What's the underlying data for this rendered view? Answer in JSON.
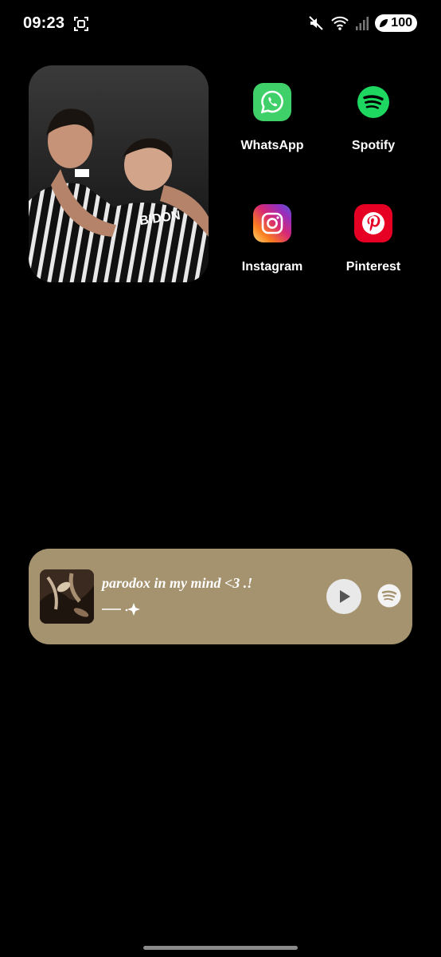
{
  "status_bar": {
    "time": "09:23",
    "battery": "100",
    "icons": [
      "screenshot-icon",
      "mute-icon",
      "wifi-icon",
      "signal-icon",
      "battery-icon"
    ]
  },
  "photo_widget": {
    "description_icon": "photo-widget"
  },
  "apps": [
    {
      "name": "WhatsApp",
      "color": "#3fd069",
      "icon": "whatsapp-icon"
    },
    {
      "name": "Spotify",
      "color": "#1ed760",
      "icon": "spotify-icon"
    },
    {
      "name": "Instagram",
      "color": "#e1306c",
      "icon": "instagram-icon"
    },
    {
      "name": "Pinterest",
      "color": "#e60023",
      "icon": "pinterest-icon"
    }
  ],
  "music_widget": {
    "title": "parodox in my mind <3 .!",
    "decoration": "── .✦",
    "background": "#a5936f",
    "play_icon": "play-icon",
    "provider_icon": "spotify-icon"
  }
}
